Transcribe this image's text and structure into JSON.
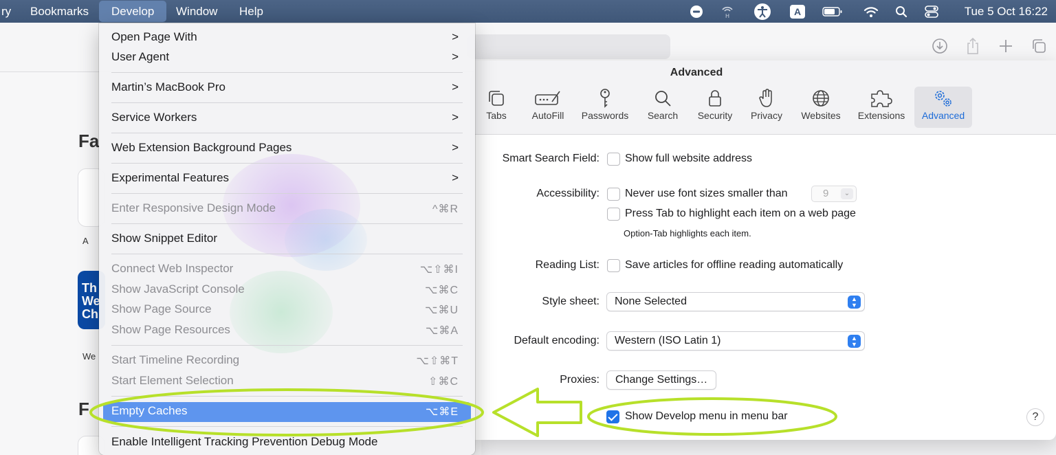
{
  "menubar": {
    "items": [
      {
        "label": "ry"
      },
      {
        "label": "Bookmarks"
      },
      {
        "label": "Develop"
      },
      {
        "label": "Window"
      },
      {
        "label": "Help"
      }
    ],
    "input_badge": "A",
    "clock": "Tue 5 Oct  16:22"
  },
  "browser": {
    "favourites_heading": "Fa",
    "frequent_heading": "F",
    "tile1_label": "A",
    "tile2_text": "Th We Ch",
    "tile2_label": "We"
  },
  "prefs": {
    "title": "Advanced",
    "tabs": [
      {
        "label": "Tabs"
      },
      {
        "label": "AutoFill"
      },
      {
        "label": "Passwords"
      },
      {
        "label": "Search"
      },
      {
        "label": "Security"
      },
      {
        "label": "Privacy"
      },
      {
        "label": "Websites"
      },
      {
        "label": "Extensions"
      },
      {
        "label": "Advanced"
      }
    ],
    "smart_search_label": "Smart Search Field:",
    "smart_search_option": "Show full website address",
    "accessibility_label": "Accessibility:",
    "font_size_option": "Never use font sizes smaller than",
    "font_size_value": "9",
    "press_tab_option": "Press Tab to highlight each item on a web page",
    "option_tab_note": "Option-Tab highlights each item.",
    "reading_list_label": "Reading List:",
    "reading_list_option": "Save articles for offline reading automatically",
    "style_sheet_label": "Style sheet:",
    "style_sheet_value": "None Selected",
    "encoding_label": "Default encoding:",
    "encoding_value": "Western (ISO Latin 1)",
    "proxies_label": "Proxies:",
    "proxies_button": "Change Settings…",
    "develop_menu_option": "Show Develop menu in menu bar",
    "develop_menu_checked": true,
    "help": "?"
  },
  "develop_menu": {
    "items": [
      {
        "label": "Open Page With",
        "arrow": ">"
      },
      {
        "label": "User Agent",
        "arrow": ">"
      },
      {
        "label": "Martin’s MacBook Pro",
        "arrow": ">"
      },
      {
        "label": "Service Workers",
        "arrow": ">"
      },
      {
        "label": "Web Extension Background Pages",
        "arrow": ">"
      },
      {
        "label": "Experimental Features",
        "arrow": ">"
      },
      {
        "label": "Enter Responsive Design Mode",
        "shortcut": "^⌘R"
      },
      {
        "label": "Show Snippet Editor"
      },
      {
        "label": "Connect Web Inspector",
        "shortcut": "⌥⇧⌘I"
      },
      {
        "label": "Show JavaScript Console",
        "shortcut": "⌥⌘C"
      },
      {
        "label": "Show Page Source",
        "shortcut": "⌥⌘U"
      },
      {
        "label": "Show Page Resources",
        "shortcut": "⌥⌘A"
      },
      {
        "label": "Start Timeline Recording",
        "shortcut": "⌥⇧⌘T"
      },
      {
        "label": "Start Element Selection",
        "shortcut": "⇧⌘C"
      },
      {
        "label": "Empty Caches",
        "shortcut": "⌥⌘E"
      },
      {
        "label": "Enable Intelligent Tracking Prevention Debug Mode"
      }
    ]
  },
  "colors": {
    "menubar": "#3f5778",
    "menu_highlight": "#5e95ee",
    "accent": "#1f73e8",
    "annotation": "#b7e02a"
  }
}
